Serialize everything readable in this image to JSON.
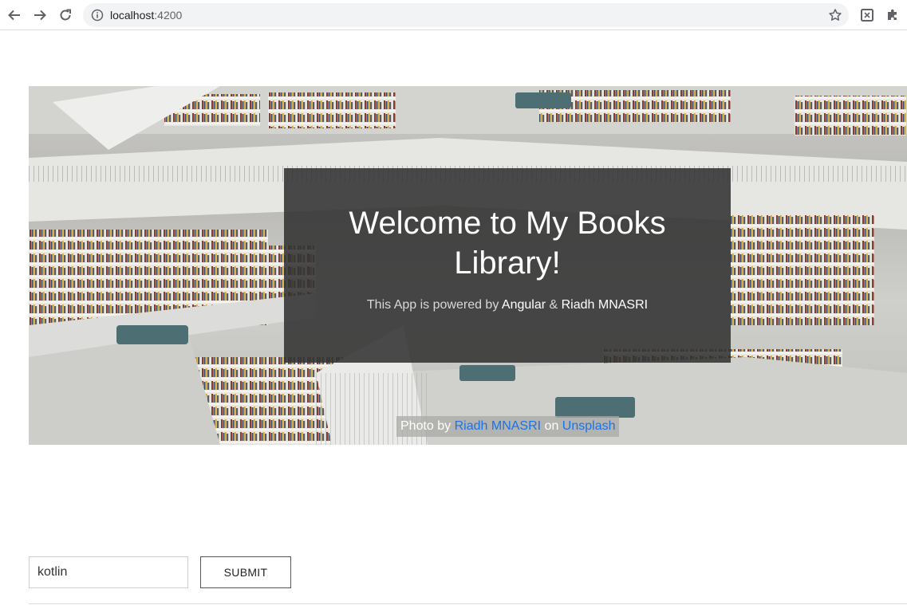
{
  "browser": {
    "url_host": "localhost",
    "url_port": ":4200",
    "icons": {
      "back": "back-arrow-icon",
      "forward": "forward-arrow-icon",
      "reload": "reload-icon",
      "info": "info-icon",
      "star": "star-icon",
      "extension": "extension-icon",
      "puzzle": "puzzle-icon"
    }
  },
  "hero": {
    "title_line1": "Welcome to My Books",
    "title_line2": "Library!",
    "subtitle_prefix": "This App is powered by ",
    "subtitle_tech": "Angular",
    "subtitle_amp": " & ",
    "subtitle_author": "Riadh MNASRI",
    "credit_prefix": "Photo by ",
    "credit_author": "Riadh MNASRI",
    "credit_mid": " on ",
    "credit_site": "Unsplash"
  },
  "search": {
    "value": "kotlin",
    "submit_label": "SUBMIT"
  },
  "colors": {
    "overlay": "#323232",
    "link": "#1a73e8"
  }
}
